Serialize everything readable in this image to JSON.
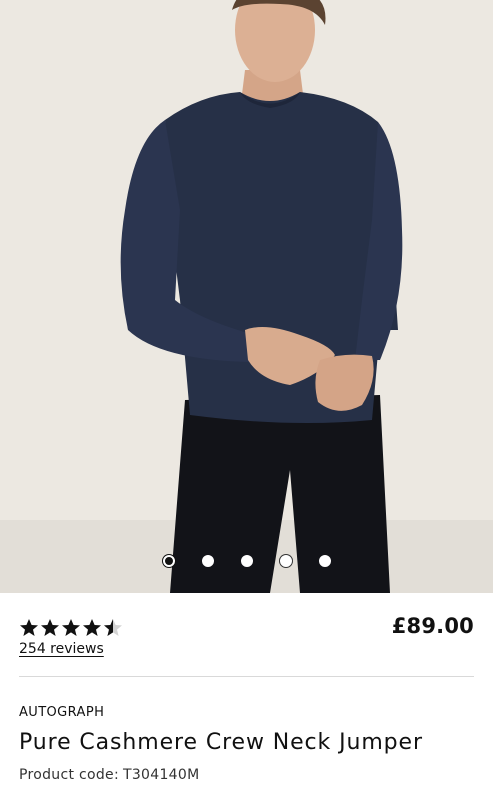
{
  "product": {
    "image_alt": "",
    "carousel": {
      "total": 5,
      "active_index": 0
    },
    "rating": {
      "value": 4.5,
      "max": 5,
      "reviews_label": "254 reviews"
    },
    "price": "£89.00",
    "brand": "AUTOGRAPH",
    "title": "Pure Cashmere Crew Neck Jumper",
    "code_label": "Product code:",
    "code_value": "T304140M"
  },
  "colors": {
    "jumper": "#263047",
    "trousers": "#121318",
    "skin": "#d8ab8e",
    "background": "#ece8e1",
    "text": "#111111"
  }
}
